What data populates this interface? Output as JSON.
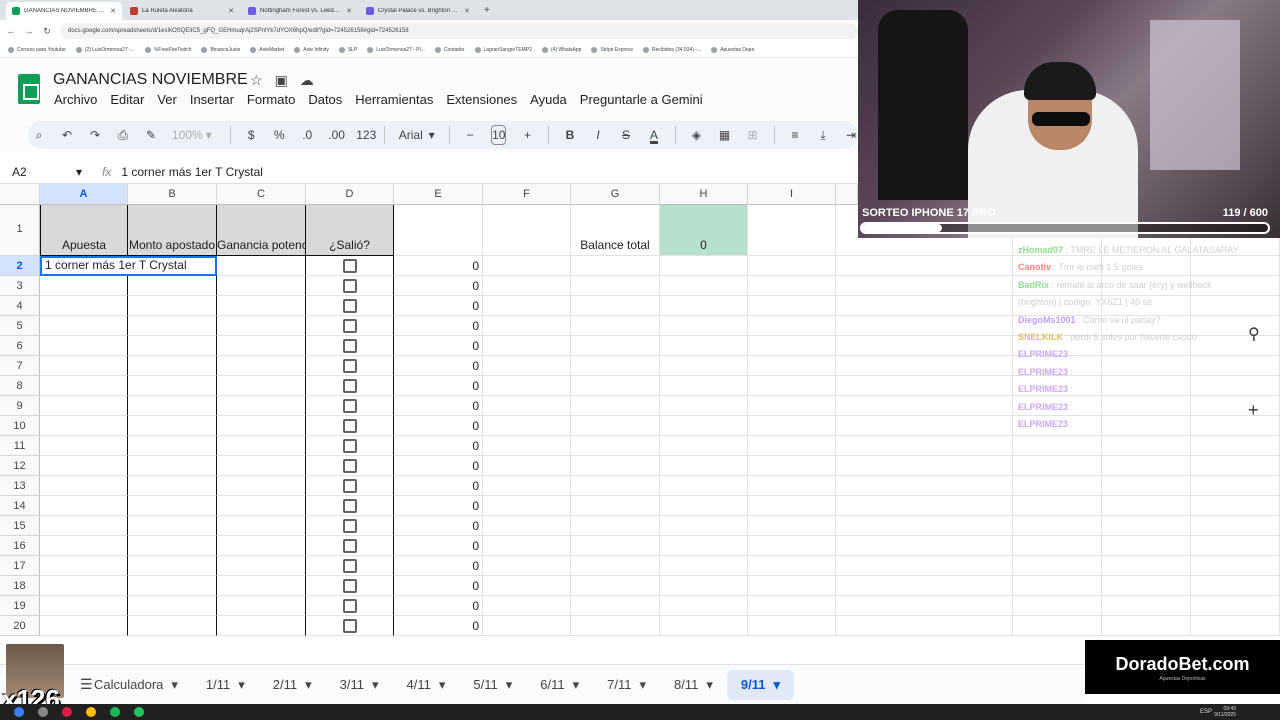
{
  "browser": {
    "tabs": [
      {
        "title": "GANANCIAS NOVIEMBRE - Hoj",
        "color": "#0f9d58",
        "active": true
      },
      {
        "title": "La Ruleta Aleatoria",
        "color": "#c0392b",
        "active": false
      },
      {
        "title": "Nottingham Forest vs. Leeds U",
        "color": "#6c5ce7",
        "active": false
      },
      {
        "title": "Crystal Palace vs. Brighton & H",
        "color": "#6c5ce7",
        "active": false
      }
    ],
    "new_tab": "+",
    "url": "docs.google.com/spreadsheets/d/1esIkOSQEiIC5_gFQ_GEHmuqrAj2SPnlYk7dYOX6hpQ/edit?gid=724526158#gid=724526158",
    "bookmarks": [
      "Correos para Youtube",
      "(2) LuisOrmenoa27 -...",
      "%FreeFireTwitch",
      "BinanceJuxie",
      "AxieMarket",
      "Axie Infinity",
      "SLP",
      "LuisOrmenoa27 - Pl...",
      "Contador",
      "LagranSangreTEMP2",
      "(4) WhatsApp",
      "Stripe Express",
      "Recibidos (34,934) -...",
      "Apuestas Depo"
    ]
  },
  "sheets": {
    "title": "GANANCIAS NOVIEMBRE",
    "menu": [
      "Archivo",
      "Editar",
      "Ver",
      "Insertar",
      "Formato",
      "Datos",
      "Herramientas",
      "Extensiones",
      "Ayuda",
      "Preguntarle a Gemini"
    ],
    "toolbar": {
      "zoom": "100%",
      "currency": "$",
      "percent": "%",
      "dec_less": ".0",
      "dec_more": ".00",
      "number_format": "123",
      "font": "Arial",
      "font_size": "10",
      "minus": "−",
      "plus": "+",
      "bold": "B",
      "italic": "I",
      "strike": "S",
      "color": "A"
    },
    "name_box": "A2",
    "formula": "1 corner más 1er T Crystal",
    "columns": [
      "A",
      "B",
      "C",
      "D",
      "E",
      "F",
      "G",
      "H",
      "I"
    ],
    "header_row": {
      "A": "Apuesta",
      "B": "Monto apostado",
      "C": "Ganancia potencial/Valor de cashout",
      "D": "¿Salió?",
      "G": "Balance total",
      "H": "0"
    },
    "active_cell_text": "1 corner más 1er T Crystal",
    "rows": [
      "1",
      "2",
      "3",
      "4",
      "5",
      "6",
      "7",
      "8",
      "9",
      "10",
      "11",
      "12",
      "13",
      "14",
      "15",
      "16",
      "17",
      "18",
      "19",
      "20"
    ],
    "e_values": [
      "0",
      "0",
      "0",
      "0",
      "0",
      "0",
      "0",
      "0",
      "0",
      "0",
      "0",
      "0",
      "0",
      "0",
      "0",
      "0",
      "0",
      "0",
      "0"
    ],
    "sheet_tabs": [
      "Calculadora",
      "1/11",
      "2/11",
      "3/11",
      "4/11",
      "5/11",
      "6/11",
      "7/11",
      "8/11",
      "9/11"
    ],
    "active_sheet": "9/11"
  },
  "stream": {
    "giveaway_label": "SORTEO IPHONE 17 PRO",
    "giveaway_count": "119  / 600",
    "giveaway_progress": 0.198,
    "chat": [
      {
        "user": "zHomad07",
        "text": ": TMRE LE METIERON AL GALATASARAY",
        "color": "#7bd47b"
      },
      {
        "user": "Canotiv",
        "text": ": Tmr le metí 1.5 goles",
        "color": "#ff6b6b"
      },
      {
        "user": "BadRix",
        "text": ": remate al arco de saar (ery) y wellbeck",
        "color": "#7bd47b"
      },
      {
        "user": "",
        "text": "(brighton) | codigo: YX6Z1 | 40 se",
        "color": "#c7c7c7"
      },
      {
        "user": "DiegoMs1001",
        "text": ": Cómo va ul parlay?",
        "color": "#b48cff"
      },
      {
        "user": "SNELKILK",
        "text": ": perdí 5 soles por hacerte casoó",
        "color": "#e0b44c"
      },
      {
        "user": "ELPRIME23",
        "text": ":",
        "color": "#c49bff"
      },
      {
        "user": "ELPRIME23",
        "text": ":",
        "color": "#c49bff"
      },
      {
        "user": "ELPRIME23",
        "text": ":",
        "color": "#c49bff"
      },
      {
        "user": "ELPRIME23",
        "text": ":",
        "color": "#c49bff"
      },
      {
        "user": "ELPRIME23",
        "text": ":",
        "color": "#c49bff"
      }
    ],
    "emote_label": "x126",
    "brand_name": "DoradoBet.com",
    "brand_sub": "Apuestas Deportivas"
  },
  "taskbar": {
    "lang": "ESP",
    "time": "09:49",
    "date": "9/11/2025"
  }
}
